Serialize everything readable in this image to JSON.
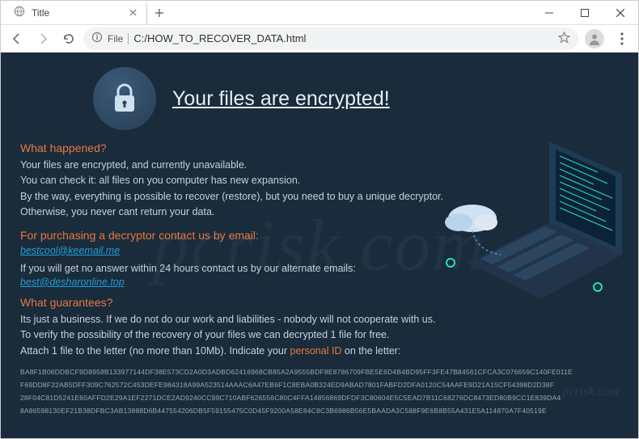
{
  "tab": {
    "title": "Title"
  },
  "file_badge": "File",
  "address": "C:/HOW_TO_RECOVER_DATA.html",
  "hero_title": "Your files are encrypted!",
  "s1": {
    "title": "What happened?",
    "l1": "Your files are encrypted, and currently unavailable.",
    "l2": "You can check it: all files on you computer has new expansion.",
    "l3": "By the way, everything is possible to recover (restore), but you need to buy a unique decryptor.",
    "l4": "Otherwise, you never cant return your data."
  },
  "s2": {
    "title": "For purchasing a decryptor contact us by email:",
    "email1": "bestcool@keemail.me",
    "note": "If you will get no answer within 24 hours contact us by our alternate emails:",
    "email2": "best@desharonline.top"
  },
  "s3": {
    "title": "What guarantees?",
    "l1": "Its just a business. If we do not do our work and liabilities - nobody will not cooperate with us.",
    "l2": "To verify the possibility of the recovery of your files we can decrypted 1 file for free.",
    "l3a": "Attach 1 file to the letter (no more than 10Mb). Indicate your ",
    "l3b": "personal ID",
    "l3c": " on the letter:"
  },
  "ids": [
    "BA8F1B06DDBCF9D8958B133977144DF38E573CD2A0D3ADBD62416968CB85A2A9555BDF8E8786709FBE5E6D4B4BD95FF3FE47B84561CFCA3C076659C140FE011E",
    "F69DD8F22AB5DFF309C762572C453DEFE984318A99A523514AAAC6A47EB6F1C8EBA0B324ED9ABAD7801FABFD2DFA0120C54AAFE9D21A15CF54398D2D38F",
    "28F04C81D5241E60AFFD2E29A1EF2271DCE2AD9240CC99C710ABF626556C80C4FFA14856869DFDF3C80604E5C5EAD7B11C68276DC8473ED80B9CC1E839DA4",
    "8A86598130EF21B38DFBC3AB13888D6B447554206DB5F59155475C0D45F9200A58E84C8C3B6986B56E5BAADA3C588F9E6B8B55A431E5A114870A7F40519E"
  ],
  "watermark": "pcrisk.com",
  "watermark_small": "pcrisk.com"
}
